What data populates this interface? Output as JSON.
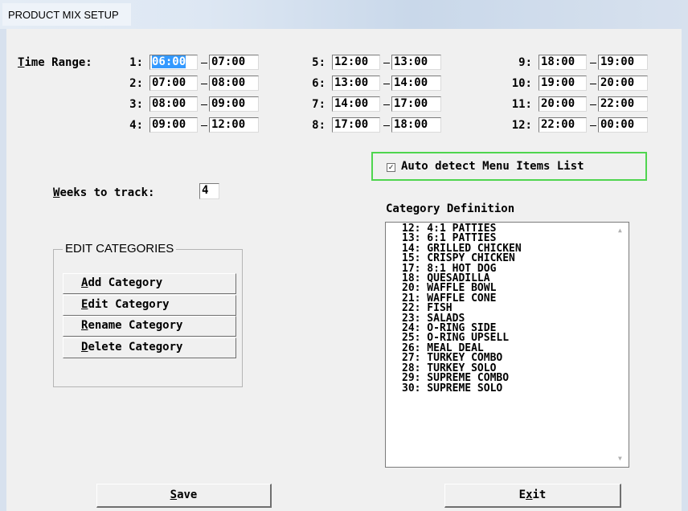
{
  "window": {
    "title": "PRODUCT MIX SETUP"
  },
  "time_range": {
    "label_first": "T",
    "label_rest": "ime Range:",
    "slots": [
      {
        "index": "1:",
        "start": "06:00",
        "end": "07:00",
        "start_selected": true
      },
      {
        "index": "2:",
        "start": "07:00",
        "end": "08:00"
      },
      {
        "index": "3:",
        "start": "08:00",
        "end": "09:00"
      },
      {
        "index": "4:",
        "start": "09:00",
        "end": "12:00"
      },
      {
        "index": "5:",
        "start": "12:00",
        "end": "13:00"
      },
      {
        "index": "6:",
        "start": "13:00",
        "end": "14:00"
      },
      {
        "index": "7:",
        "start": "14:00",
        "end": "17:00"
      },
      {
        "index": "8:",
        "start": "17:00",
        "end": "18:00"
      },
      {
        "index": "9:",
        "start": "18:00",
        "end": "19:00"
      },
      {
        "index": "10:",
        "start": "19:00",
        "end": "20:00"
      },
      {
        "index": "11:",
        "start": "20:00",
        "end": "22:00"
      },
      {
        "index": "12:",
        "start": "22:00",
        "end": "00:00"
      }
    ]
  },
  "weeks": {
    "label_first": "W",
    "label_rest": "eeks to track:",
    "value": "4"
  },
  "auto_detect": {
    "checked": true,
    "check_glyph": "✓",
    "label": "Auto detect Menu Items List"
  },
  "edit_categories": {
    "title": "EDIT CATEGORIES",
    "buttons": [
      {
        "key": "A",
        "rest": "dd Category"
      },
      {
        "key": "E",
        "rest": "dit Category"
      },
      {
        "key": "R",
        "rest": "ename Category"
      },
      {
        "key": "D",
        "rest": "elete Category"
      }
    ]
  },
  "category_definition": {
    "label": "Category Definition",
    "items": [
      "12: 4:1 PATTIES",
      "13: 6:1 PATTIES",
      "14: GRILLED CHICKEN",
      "15: CRISPY CHICKEN",
      "17: 8:1 HOT DOG",
      "18: QUESADILLA",
      "20: WAFFLE BOWL",
      "21: WAFFLE CONE",
      "22: FISH",
      "23: SALADS",
      "24: O-RING SIDE",
      "25: O-RING UPSELL",
      "26: MEAL DEAL",
      "27: TURKEY COMBO",
      "28: TURKEY SOLO",
      "29: SUPREME COMBO",
      "30: SUPREME SOLO"
    ],
    "scroll_up_icon": "▲",
    "scroll_down_icon": "▼"
  },
  "footer": {
    "save": {
      "key": "S",
      "rest": "ave"
    },
    "exit": {
      "pre": "E",
      "key": "x",
      "rest": "it"
    }
  }
}
